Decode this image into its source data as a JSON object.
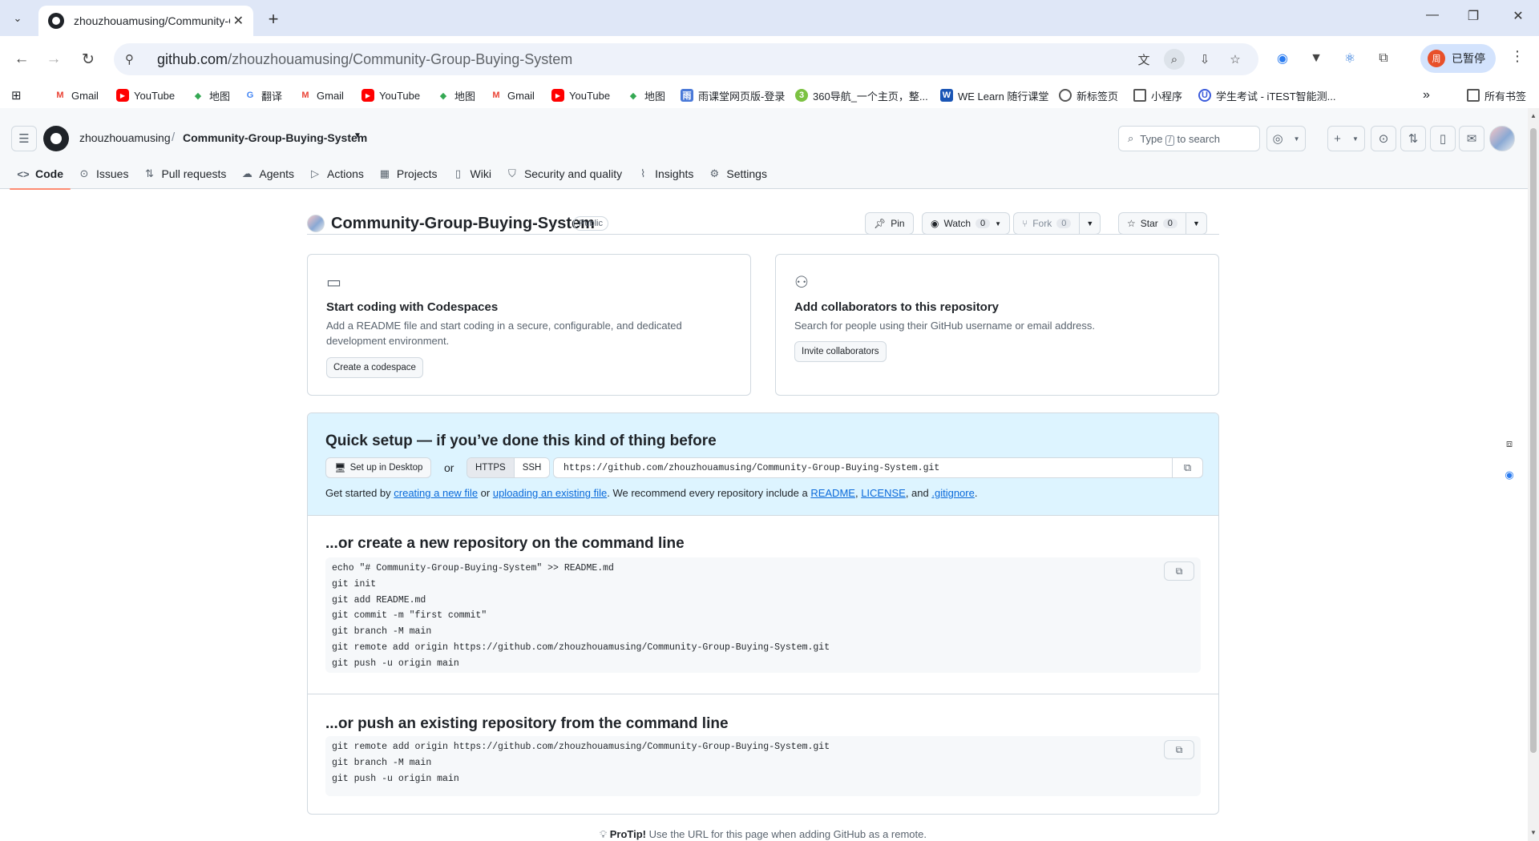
{
  "browser": {
    "tab_title": "zhouzhouamusing/Community-Gr",
    "url_host": "github.com",
    "url_path": "/zhouzhouamusing/Community-Group-Buying-System",
    "profile_label": "已暂停",
    "profile_initial": "周"
  },
  "bookmarks": [
    {
      "label": "Gmail",
      "icon": "gmail-icon",
      "glyph": "M"
    },
    {
      "label": "YouTube",
      "icon": "youtube-icon",
      "glyph": "▶"
    },
    {
      "label": "地图",
      "icon": "maps-icon",
      "glyph": "◆"
    },
    {
      "label": "翻译",
      "icon": "translate-icon",
      "glyph": "G"
    },
    {
      "label": "Gmail",
      "icon": "gmail-icon",
      "glyph": "M"
    },
    {
      "label": "YouTube",
      "icon": "youtube-icon",
      "glyph": "▶"
    },
    {
      "label": "地图",
      "icon": "maps-icon",
      "glyph": "◆"
    },
    {
      "label": "Gmail",
      "icon": "gmail-icon",
      "glyph": "M"
    },
    {
      "label": "YouTube",
      "icon": "youtube-icon",
      "glyph": "▶"
    },
    {
      "label": "地图",
      "icon": "maps-icon",
      "glyph": "◆"
    },
    {
      "label": "雨课堂网页版-登录",
      "icon": "rain-classroom-icon",
      "glyph": "雨"
    },
    {
      "label": "360导航_一个主页，整...",
      "icon": "360-icon",
      "glyph": "3"
    },
    {
      "label": "WE Learn 随行课堂",
      "icon": "welearn-icon",
      "glyph": "W"
    },
    {
      "label": "新标签页",
      "icon": "chrome-icon",
      "glyph": ""
    },
    {
      "label": "小程序",
      "icon": "folder-icon",
      "glyph": ""
    },
    {
      "label": "学生考试 - iTEST智能测...",
      "icon": "itest-icon",
      "glyph": "U"
    }
  ],
  "bookmarks_all": "所有书签",
  "github": {
    "owner": "zhouzhouamusing",
    "repo": "Community-Group-Buying-System",
    "search_pre": "Type",
    "search_key": "/",
    "search_post": "to search",
    "nav": [
      {
        "label": "Code",
        "icon": "code-icon",
        "glyph": "<>"
      },
      {
        "label": "Issues",
        "icon": "issue-icon",
        "glyph": "⊙"
      },
      {
        "label": "Pull requests",
        "icon": "pull-request-icon",
        "glyph": "⇅"
      },
      {
        "label": "Agents",
        "icon": "agents-icon",
        "glyph": "☁"
      },
      {
        "label": "Actions",
        "icon": "actions-icon",
        "glyph": "▷"
      },
      {
        "label": "Projects",
        "icon": "projects-icon",
        "glyph": "▦"
      },
      {
        "label": "Wiki",
        "icon": "wiki-icon",
        "glyph": "▯"
      },
      {
        "label": "Security and quality",
        "icon": "shield-icon",
        "glyph": "⛉"
      },
      {
        "label": "Insights",
        "icon": "graph-icon",
        "glyph": "⌇"
      },
      {
        "label": "Settings",
        "icon": "gear-icon",
        "glyph": "⚙"
      }
    ]
  },
  "repo_header": {
    "name": "Community-Group-Buying-System",
    "visibility": "Public",
    "pin": "Pin",
    "watch": "Watch",
    "watch_count": "0",
    "fork": "Fork",
    "fork_count": "0",
    "star": "Star",
    "star_count": "0"
  },
  "cards": {
    "codespaces": {
      "title": "Start coding with Codespaces",
      "desc": "Add a README file and start coding in a secure, configurable, and dedicated development environment.",
      "button": "Create a codespace"
    },
    "collaborators": {
      "title": "Add collaborators to this repository",
      "desc": "Search for people using their GitHub username or email address.",
      "button": "Invite collaborators"
    }
  },
  "quick_setup": {
    "title": "Quick setup — if you’ve done this kind of thing before",
    "desktop_button": "Set up in Desktop",
    "or": "or",
    "https": "HTTPS",
    "ssh": "SSH",
    "clone_url": "https://github.com/zhouzhouamusing/Community-Group-Buying-System.git",
    "get_started": {
      "p1": "Get started by ",
      "link1": "creating a new file",
      "p2": " or ",
      "link2": "uploading an existing file",
      "p3": ". We recommend every repository include a ",
      "link3": "README",
      "p4": ", ",
      "link4": "LICENSE",
      "p5": ", and ",
      "link5": ".gitignore",
      "p6": "."
    }
  },
  "new_repo": {
    "title": "...or create a new repository on the command line",
    "code": "echo \"# Community-Group-Buying-System\" >> README.md\ngit init\ngit add README.md\ngit commit -m \"first commit\"\ngit branch -M main\ngit remote add origin https://github.com/zhouzhouamusing/Community-Group-Buying-System.git\ngit push -u origin main"
  },
  "push_existing": {
    "title": "...or push an existing repository from the command line",
    "code": "git remote add origin https://github.com/zhouzhouamusing/Community-Group-Buying-System.git\ngit branch -M main\ngit push -u origin main"
  },
  "protip": {
    "label": "ProTip!",
    "text": " Use the URL for this page when adding GitHub as a remote."
  }
}
